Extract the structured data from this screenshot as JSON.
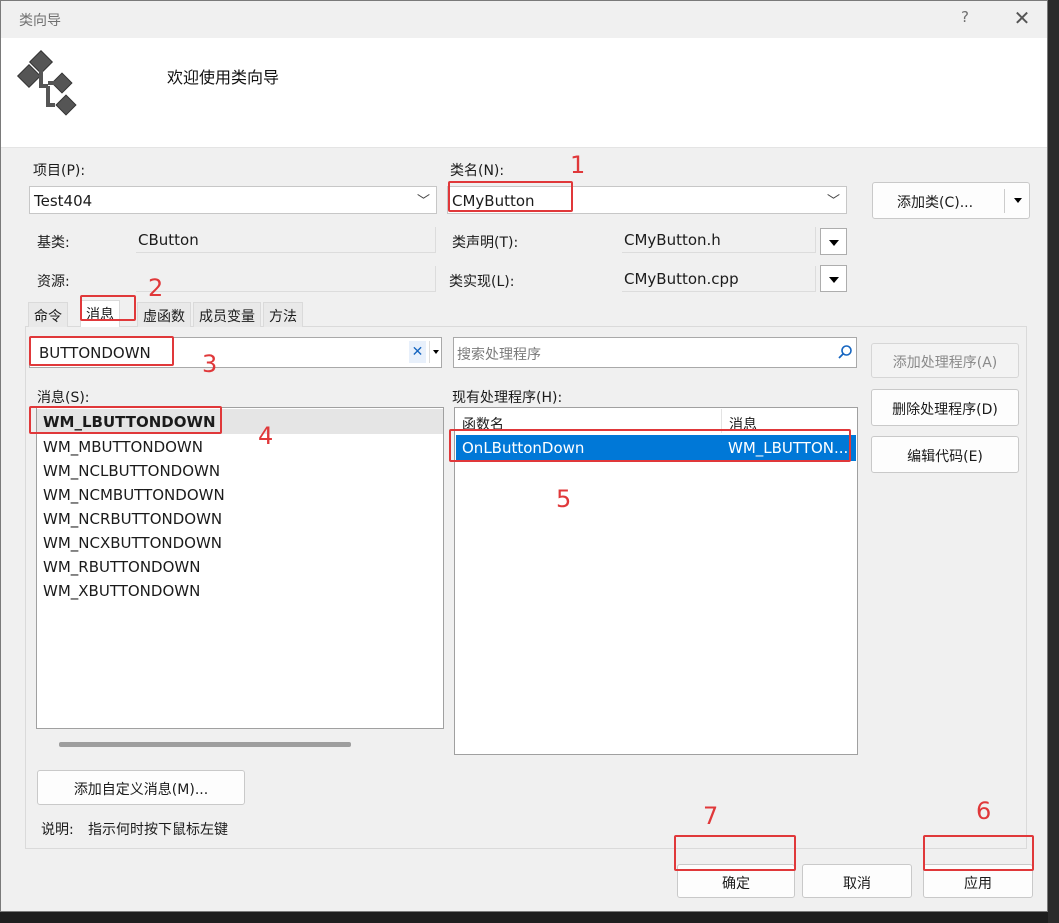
{
  "window": {
    "title": "类向导",
    "help_label": "?",
    "close_label": "✕"
  },
  "banner": {
    "title": "欢迎使用类向导",
    "icon": "class-hierarchy-icon"
  },
  "fields": {
    "project_label": "项目(P):",
    "project_value": "Test404",
    "classname_label": "类名(N):",
    "classname_value": "CMyButton",
    "add_class_label": "添加类(C)...",
    "base_label": "基类:",
    "base_value": "CButton",
    "resource_label": "资源:",
    "resource_value": "",
    "decl_label": "类声明(T):",
    "decl_value": "CMyButton.h",
    "impl_label": "类实现(L):",
    "impl_value": "CMyButton.cpp"
  },
  "tabs": [
    {
      "label": "命令"
    },
    {
      "label": "消息"
    },
    {
      "label": "虚函数"
    },
    {
      "label": "成员变量"
    },
    {
      "label": "方法"
    }
  ],
  "messages_tab": {
    "filter_value": "BUTTONDOWN",
    "clear_icon": "✕",
    "search_placeholder": "搜索处理程序",
    "messages_label": "消息(S):",
    "messages": [
      "WM_LBUTTONDOWN",
      "WM_MBUTTONDOWN",
      "WM_NCLBUTTONDOWN",
      "WM_NCMBUTTONDOWN",
      "WM_NCRBUTTONDOWN",
      "WM_NCXBUTTONDOWN",
      "WM_RBUTTONDOWN",
      "WM_XBUTTONDOWN"
    ],
    "handlers_label": "现有处理程序(H):",
    "handler_col_func": "函数名",
    "handler_col_msg": "消息",
    "handlers": [
      {
        "func": "OnLButtonDown",
        "msg": "WM_LBUTTON..."
      }
    ],
    "add_handler": "添加处理程序(A)",
    "delete_handler": "删除处理程序(D)",
    "edit_code": "编辑代码(E)",
    "add_custom": "添加自定义消息(M)...",
    "desc_label": "说明:",
    "desc_text": "指示何时按下鼠标左键"
  },
  "footer": {
    "ok": "确定",
    "cancel": "取消",
    "apply": "应用"
  },
  "annotations": [
    "1",
    "2",
    "3",
    "4",
    "5",
    "6",
    "7"
  ],
  "colors": {
    "annotation_red": "#e0383a",
    "selection_blue": "#0078d7"
  }
}
